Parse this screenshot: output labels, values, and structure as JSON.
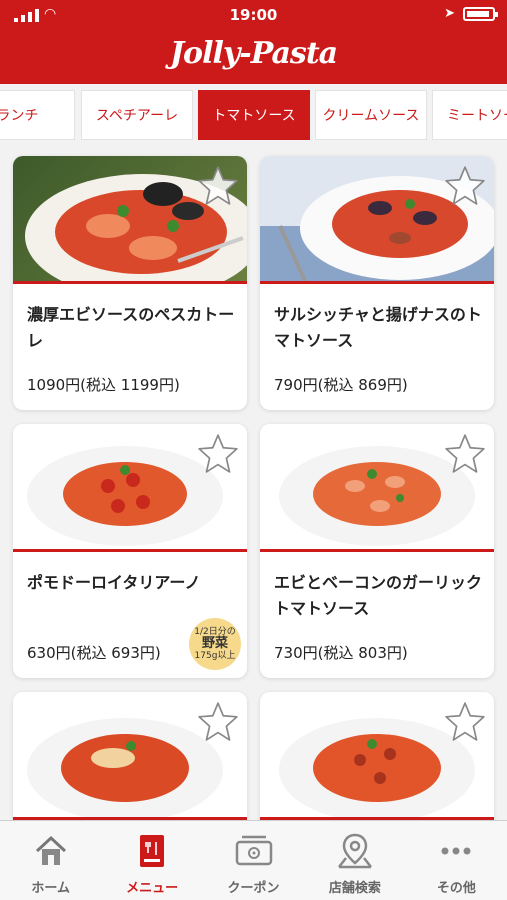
{
  "status_bar": {
    "time": "19:00"
  },
  "header": {
    "logo_text": "Jolly-Pasta"
  },
  "tabs": [
    {
      "label": "ランチ"
    },
    {
      "label": "スペチアーレ"
    },
    {
      "label": "トマトソース",
      "active": true
    },
    {
      "label": "クリームソース"
    },
    {
      "label": "ミートソース"
    }
  ],
  "badge": {
    "top": "1/2日分の",
    "mid": "野菜",
    "bottom": "175g以上"
  },
  "products": [
    {
      "name": "濃厚エビソースのペスカトーレ",
      "price": "1090円(税込 1199円)"
    },
    {
      "name": "サルシッチャと揚げナスのトマトソース",
      "price": "790円(税込 869円)"
    },
    {
      "name": "ポモドーロイタリアーノ",
      "price": "630円(税込 693円)"
    },
    {
      "name": "エビとベーコンのガーリックトマトソース",
      "price": "730円(税込 803円)"
    },
    {
      "name": "",
      "price": ""
    },
    {
      "name": "",
      "price": ""
    }
  ],
  "bottom_nav": [
    {
      "label": "ホーム",
      "icon": "home-icon"
    },
    {
      "label": "メニュー",
      "icon": "menu-icon",
      "active": true
    },
    {
      "label": "クーポン",
      "icon": "coupon-icon"
    },
    {
      "label": "店舗検索",
      "icon": "store-search-icon"
    },
    {
      "label": "その他",
      "icon": "more-icon"
    }
  ],
  "colors": {
    "brand_red": "#cc1a1a"
  }
}
